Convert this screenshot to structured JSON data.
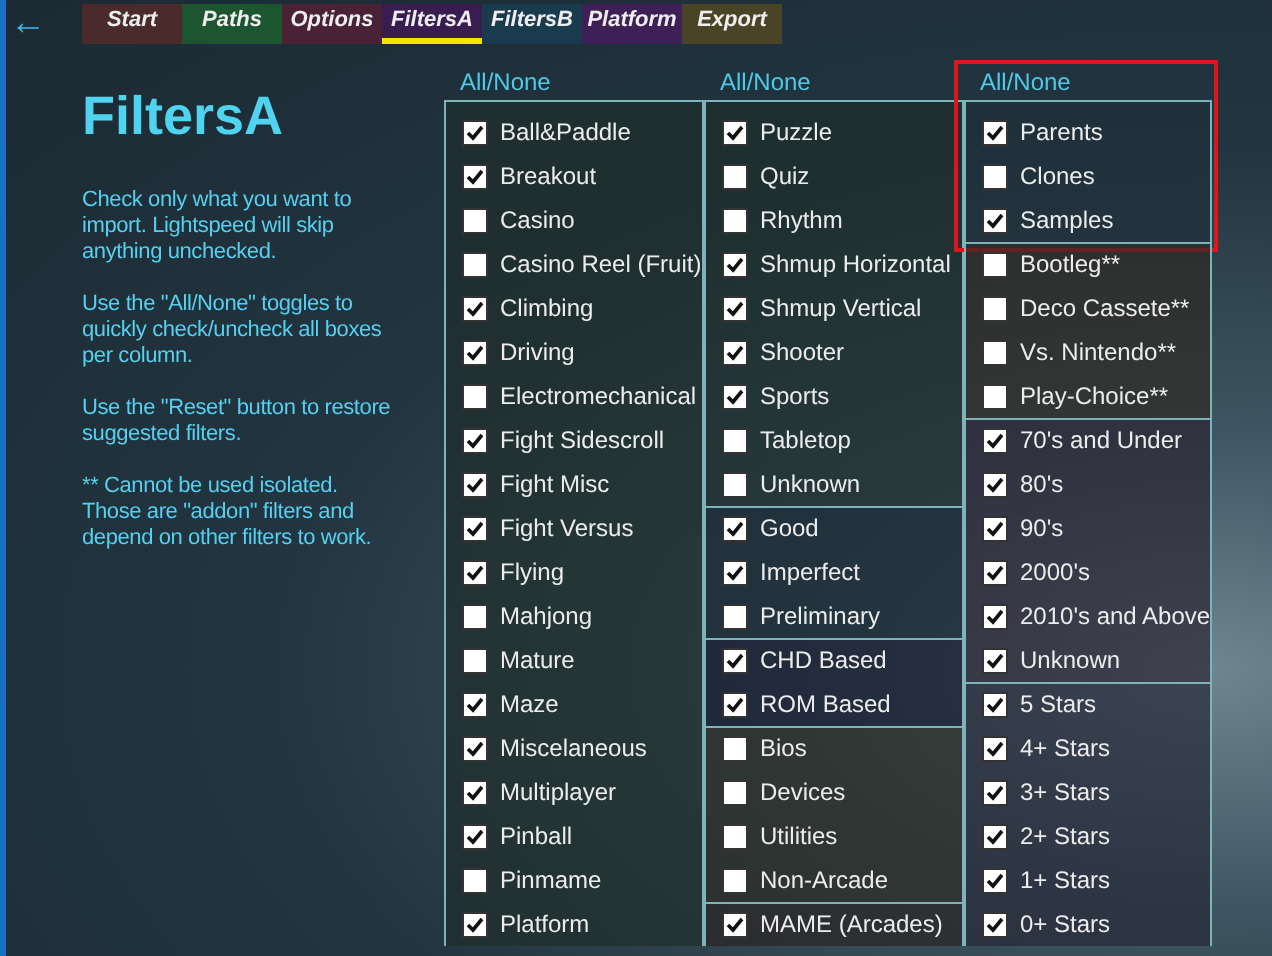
{
  "back_button": "←",
  "tabs": [
    {
      "label": "Start",
      "color": "#4a2b2b",
      "selected": false
    },
    {
      "label": "Paths",
      "color": "#1c5530",
      "selected": false
    },
    {
      "label": "Options",
      "color": "#4a2236",
      "selected": false
    },
    {
      "label": "FiltersA",
      "color": "#3a1d50",
      "selected": true
    },
    {
      "label": "FiltersB",
      "color": "#1a3a4e",
      "selected": false
    },
    {
      "label": "Platform",
      "color": "#3e1f56",
      "selected": false
    },
    {
      "label": "Export",
      "color": "#4a4427",
      "selected": false
    }
  ],
  "title": "FiltersA",
  "help": [
    "Check only what you want to import. Lightspeed will skip anything unchecked.",
    "Use the \"All/None\" toggles to quickly check/uncheck all boxes per column.",
    "Use the \"Reset\" button to restore suggested filters.",
    "** Cannot be used isolated. Those are \"addon\" filters and depend on other filters to work."
  ],
  "columns": [
    {
      "toggle": "All/None",
      "groups": [
        {
          "highlighted": false,
          "items": [
            {
              "label": "Ball&Paddle",
              "checked": true
            },
            {
              "label": "Breakout",
              "checked": true
            },
            {
              "label": "Casino",
              "checked": false
            },
            {
              "label": "Casino Reel (Fruit)",
              "checked": false
            },
            {
              "label": "Climbing",
              "checked": true
            },
            {
              "label": "Driving",
              "checked": true
            },
            {
              "label": "Electromechanical",
              "checked": false
            },
            {
              "label": "Fight Sidescroll",
              "checked": true
            },
            {
              "label": "Fight Misc",
              "checked": true
            },
            {
              "label": "Fight Versus",
              "checked": true
            },
            {
              "label": "Flying",
              "checked": true
            },
            {
              "label": "Mahjong",
              "checked": false
            },
            {
              "label": "Mature",
              "checked": false
            },
            {
              "label": "Maze",
              "checked": true
            },
            {
              "label": "Miscelaneous",
              "checked": true
            },
            {
              "label": "Multiplayer",
              "checked": true
            },
            {
              "label": "Pinball",
              "checked": true
            },
            {
              "label": "Pinmame",
              "checked": false
            },
            {
              "label": "Platform",
              "checked": true
            }
          ]
        }
      ]
    },
    {
      "toggle": "All/None",
      "groups": [
        {
          "highlighted": false,
          "items": [
            {
              "label": "Puzzle",
              "checked": true
            },
            {
              "label": "Quiz",
              "checked": false
            },
            {
              "label": "Rhythm",
              "checked": false
            },
            {
              "label": "Shmup Horizontal",
              "checked": true
            },
            {
              "label": "Shmup Vertical",
              "checked": true
            },
            {
              "label": "Shooter",
              "checked": true
            },
            {
              "label": "Sports",
              "checked": true
            },
            {
              "label": "Tabletop",
              "checked": false
            },
            {
              "label": "Unknown",
              "checked": false
            }
          ]
        },
        {
          "highlighted": false,
          "items": [
            {
              "label": "Good",
              "checked": true
            },
            {
              "label": "Imperfect",
              "checked": true
            },
            {
              "label": "Preliminary",
              "checked": false
            }
          ]
        },
        {
          "highlighted": false,
          "items": [
            {
              "label": "CHD Based",
              "checked": true
            },
            {
              "label": "ROM Based",
              "checked": true
            }
          ]
        },
        {
          "highlighted": false,
          "items": [
            {
              "label": "Bios",
              "checked": false
            },
            {
              "label": "Devices",
              "checked": false
            },
            {
              "label": "Utilities",
              "checked": false
            },
            {
              "label": "Non-Arcade",
              "checked": false
            }
          ]
        },
        {
          "highlighted": false,
          "items": [
            {
              "label": "MAME (Arcades)",
              "checked": true
            }
          ]
        }
      ]
    },
    {
      "toggle": "All/None",
      "groups": [
        {
          "highlighted": true,
          "items": [
            {
              "label": "Parents",
              "checked": true
            },
            {
              "label": "Clones",
              "checked": false
            },
            {
              "label": "Samples",
              "checked": true
            }
          ]
        },
        {
          "highlighted": false,
          "items": [
            {
              "label": "Bootleg**",
              "checked": false
            },
            {
              "label": "Deco Cassete**",
              "checked": false
            },
            {
              "label": "Vs. Nintendo**",
              "checked": false
            },
            {
              "label": "Play-Choice**",
              "checked": false
            }
          ]
        },
        {
          "highlighted": false,
          "items": [
            {
              "label": "70's and Under",
              "checked": true
            },
            {
              "label": "80's",
              "checked": true
            },
            {
              "label": "90's",
              "checked": true
            },
            {
              "label": "2000's",
              "checked": true
            },
            {
              "label": "2010's and Above",
              "checked": true
            },
            {
              "label": "Unknown",
              "checked": true
            }
          ]
        },
        {
          "highlighted": false,
          "items": [
            {
              "label": "5 Stars",
              "checked": true
            },
            {
              "label": "4+ Stars",
              "checked": true
            },
            {
              "label": "3+ Stars",
              "checked": true
            },
            {
              "label": "2+ Stars",
              "checked": true
            },
            {
              "label": "1+ Stars",
              "checked": true
            },
            {
              "label": "0+ Stars",
              "checked": true
            }
          ]
        }
      ]
    }
  ]
}
